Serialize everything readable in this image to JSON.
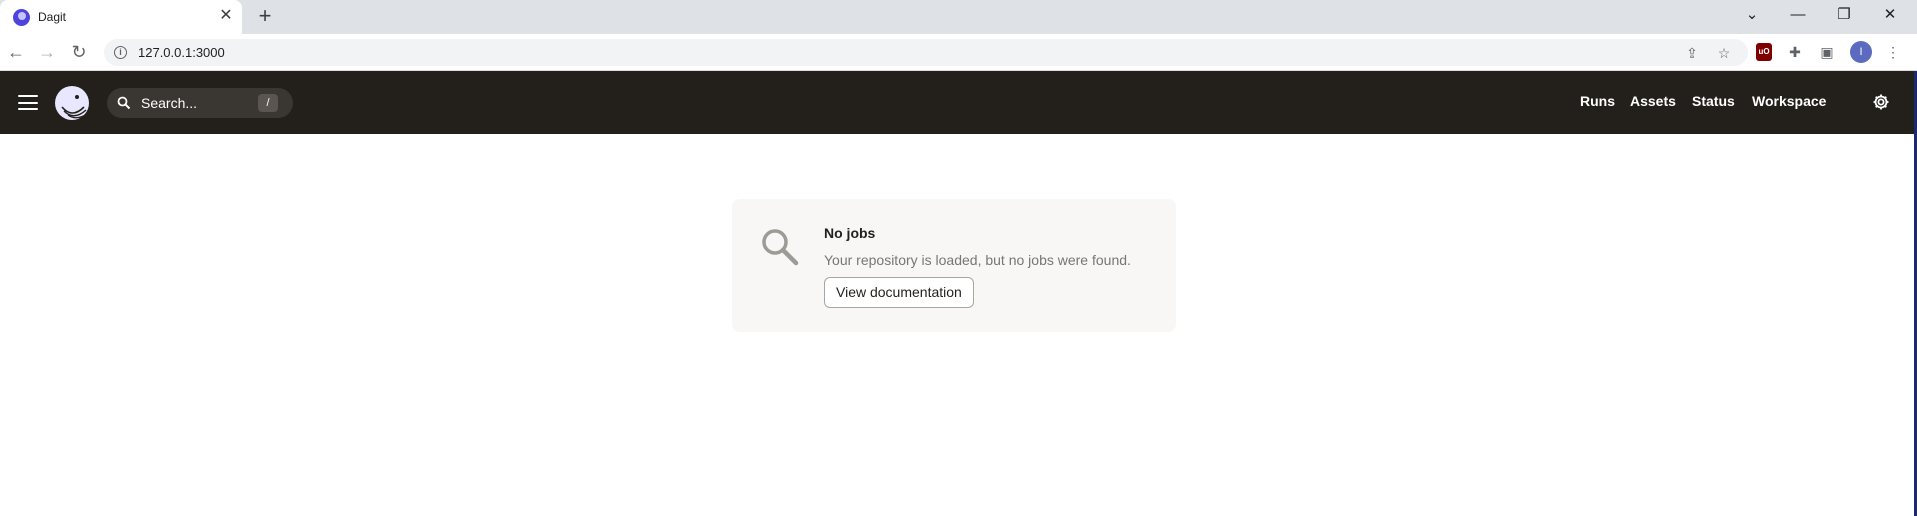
{
  "browser": {
    "tab_title": "Dagit",
    "tab_close": "✕",
    "new_tab": "+",
    "url": "127.0.0.1:3000",
    "window_controls": {
      "tab_search": "⌄",
      "minimize": "—",
      "restore": "❐",
      "close": "✕"
    },
    "nav": {
      "back": "←",
      "forward": "→",
      "reload": "↻"
    },
    "profile_initial": "I"
  },
  "app": {
    "search_placeholder": "Search...",
    "search_shortcut": "/",
    "nav_links": [
      "Runs",
      "Assets",
      "Status",
      "Workspace"
    ]
  },
  "empty_state": {
    "title": "No jobs",
    "description": "Your repository is loaded, but no jobs were found.",
    "button_label": "View documentation"
  },
  "colors": {
    "header_bg": "#231f1b",
    "card_bg": "#f8f7f5",
    "accent": "#4f43dd"
  }
}
